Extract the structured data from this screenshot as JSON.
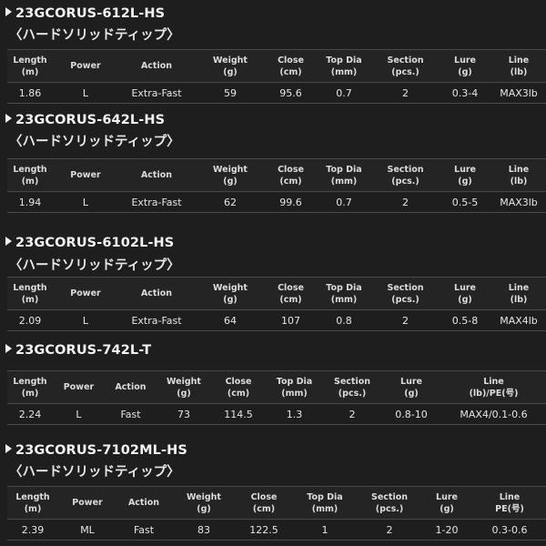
{
  "colors": {
    "background": "#1e1e1e",
    "text": "#e6e6e6",
    "border": "#4a4a4a"
  },
  "icon": "triangle-right-icon",
  "products": [
    {
      "name": "23GCORUS-612L-HS",
      "subtitle": "〈ハードソリッドティップ〉",
      "headers": [
        [
          "Length",
          "(m)"
        ],
        [
          "Power",
          ""
        ],
        [
          "Action",
          ""
        ],
        [
          "Weight",
          "(g)"
        ],
        [
          "Close",
          "(cm)"
        ],
        [
          "Top Dia",
          "(mm)"
        ],
        [
          "Section",
          "(pcs.)"
        ],
        [
          "Lure",
          "(g)"
        ],
        [
          "Line",
          "(lb)"
        ]
      ],
      "row": [
        "1.86",
        "L",
        "Extra-Fast",
        "59",
        "95.6",
        "0.7",
        "2",
        "0.3-4",
        "MAX3lb"
      ]
    },
    {
      "name": "23GCORUS-642L-HS",
      "subtitle": "〈ハードソリッドティップ〉",
      "headers": [
        [
          "Length",
          "(m)"
        ],
        [
          "Power",
          ""
        ],
        [
          "Action",
          ""
        ],
        [
          "Weight",
          "(g)"
        ],
        [
          "Close",
          "(cm)"
        ],
        [
          "Top Dia",
          "(mm)"
        ],
        [
          "Section",
          "(pcs.)"
        ],
        [
          "Lure",
          "(g)"
        ],
        [
          "Line",
          "(lb)"
        ]
      ],
      "row": [
        "1.94",
        "L",
        "Extra-Fast",
        "62",
        "99.6",
        "0.7",
        "2",
        "0.5-5",
        "MAX3lb"
      ]
    },
    {
      "name": "23GCORUS-6102L-HS",
      "subtitle": "〈ハードソリッドティップ〉",
      "headers": [
        [
          "Length",
          "(m)"
        ],
        [
          "Power",
          ""
        ],
        [
          "Action",
          ""
        ],
        [
          "Weight",
          "(g)"
        ],
        [
          "Close",
          "(cm)"
        ],
        [
          "Top Dia",
          "(mm)"
        ],
        [
          "Section",
          "(pcs.)"
        ],
        [
          "Lure",
          "(g)"
        ],
        [
          "Line",
          "(lb)"
        ]
      ],
      "row": [
        "2.09",
        "L",
        "Extra-Fast",
        "64",
        "107",
        "0.8",
        "2",
        "0.5-8",
        "MAX4lb"
      ]
    },
    {
      "name": "23GCORUS-742L-T",
      "subtitle": "",
      "headers": [
        [
          "Length",
          "(m)"
        ],
        [
          "Power",
          ""
        ],
        [
          "Action",
          ""
        ],
        [
          "Weight",
          "(g)"
        ],
        [
          "Close",
          "(cm)"
        ],
        [
          "Top Dia",
          "(mm)"
        ],
        [
          "Section",
          "(pcs.)"
        ],
        [
          "Lure",
          "(g)"
        ],
        [
          "Line",
          "(lb)/PE(号)"
        ]
      ],
      "row": [
        "2.24",
        "L",
        "Fast",
        "73",
        "114.5",
        "1.3",
        "2",
        "0.8-10",
        "MAX4/0.1-0.6"
      ]
    },
    {
      "name": "23GCORUS-7102ML-HS",
      "subtitle": "〈ハードソリッドティップ〉",
      "headers": [
        [
          "Length",
          "(m)"
        ],
        [
          "Power",
          ""
        ],
        [
          "Action",
          ""
        ],
        [
          "Weight",
          "(g)"
        ],
        [
          "Close",
          "(cm)"
        ],
        [
          "Top Dia",
          "(mm)"
        ],
        [
          "Section",
          "(pcs.)"
        ],
        [
          "Lure",
          "(g)"
        ],
        [
          "Line",
          "PE(号)"
        ]
      ],
      "row": [
        "2.39",
        "ML",
        "Fast",
        "83",
        "122.5",
        "1",
        "2",
        "1-20",
        "0.3-0.6"
      ]
    }
  ]
}
